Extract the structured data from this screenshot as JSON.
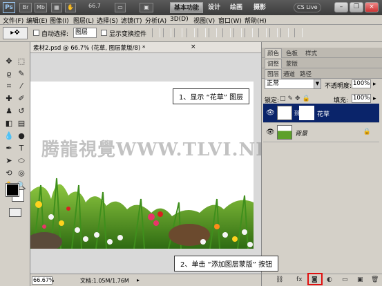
{
  "app": {
    "logo": "Ps",
    "bridge_label": "Br",
    "minibridge_label": "Mb",
    "zoom_level": "66.7",
    "workspaces": [
      "基本功能",
      "设计",
      "绘画",
      "摄影"
    ],
    "active_workspace": "基本功能",
    "cs_live": "CS Live"
  },
  "menu": [
    "文件(F)",
    "编辑(E)",
    "图像(I)",
    "图层(L)",
    "选择(S)",
    "滤镜(T)",
    "分析(A)",
    "3D(D)",
    "视图(V)",
    "窗口(W)",
    "帮助(H)"
  ],
  "options": {
    "auto_select_label": "自动选择:",
    "auto_select_value": "图层",
    "show_transform_label": "显示变换控件"
  },
  "document": {
    "tab_title": "素材2.psd @ 66.7% (花草, 图层蒙版/8) *",
    "close_glyph": "×",
    "status_zoom": "66.67%",
    "status_doc": "文档:1.05M/1.76M"
  },
  "watermark": "腾龍視覺WWW.TLVI.NET",
  "callouts": {
    "step1": "1、显示 “花草” 图层",
    "step2": "2、单击 “添加图层蒙版” 按钮"
  },
  "panels": {
    "top_tabs": [
      "颜色",
      "色板",
      "样式"
    ],
    "mid_tabs": [
      "调整",
      "蒙版"
    ],
    "layer_tabs": [
      "图层",
      "通道",
      "路径"
    ],
    "blend_mode": "正常",
    "opacity_label": "不透明度:",
    "opacity_value": "100%",
    "lock_label": "锁定:",
    "fill_label": "填充:",
    "fill_value": "100%",
    "layers": [
      {
        "name": "花草",
        "selected": true,
        "has_mask": true
      },
      {
        "name": "背景",
        "selected": false,
        "locked": true
      }
    ]
  },
  "colors": {
    "selection": "#0a246a",
    "highlight_box": "#e01010"
  }
}
